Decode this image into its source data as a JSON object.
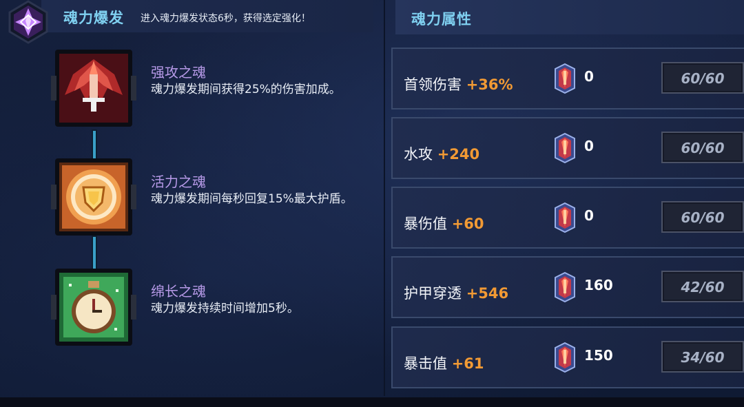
{
  "burst": {
    "title": "魂力爆发",
    "description": "进入魂力爆发状态6秒，获得选定强化！"
  },
  "souls": [
    {
      "name": "强攻之魂",
      "description": "魂力爆发期间获得25%的伤害加成。",
      "icon": "red-winged-sword-icon"
    },
    {
      "name": "活力之魂",
      "description": "魂力爆发期间每秒回复15%最大护盾。",
      "icon": "golden-shield-icon"
    },
    {
      "name": "绵长之魂",
      "description": "魂力爆发持续时间增加5秒。",
      "icon": "green-stopwatch-icon"
    }
  ],
  "attributes": {
    "title": "魂力属性",
    "rows": [
      {
        "name": "首领伤害",
        "bonus": "+36%",
        "gems": "0",
        "progress": "60/60"
      },
      {
        "name": "水攻",
        "bonus": "+240",
        "gems": "0",
        "progress": "60/60"
      },
      {
        "name": "暴伤值",
        "bonus": "+60",
        "gems": "0",
        "progress": "60/60"
      },
      {
        "name": "护甲穿透",
        "bonus": "+546",
        "gems": "160",
        "progress": "42/60"
      },
      {
        "name": "暴击值",
        "bonus": "+61",
        "gems": "150",
        "progress": "34/60"
      }
    ]
  },
  "colors": {
    "title": "#7fd0f0",
    "soul_name": "#b79ae8",
    "bonus": "#f29a34"
  }
}
